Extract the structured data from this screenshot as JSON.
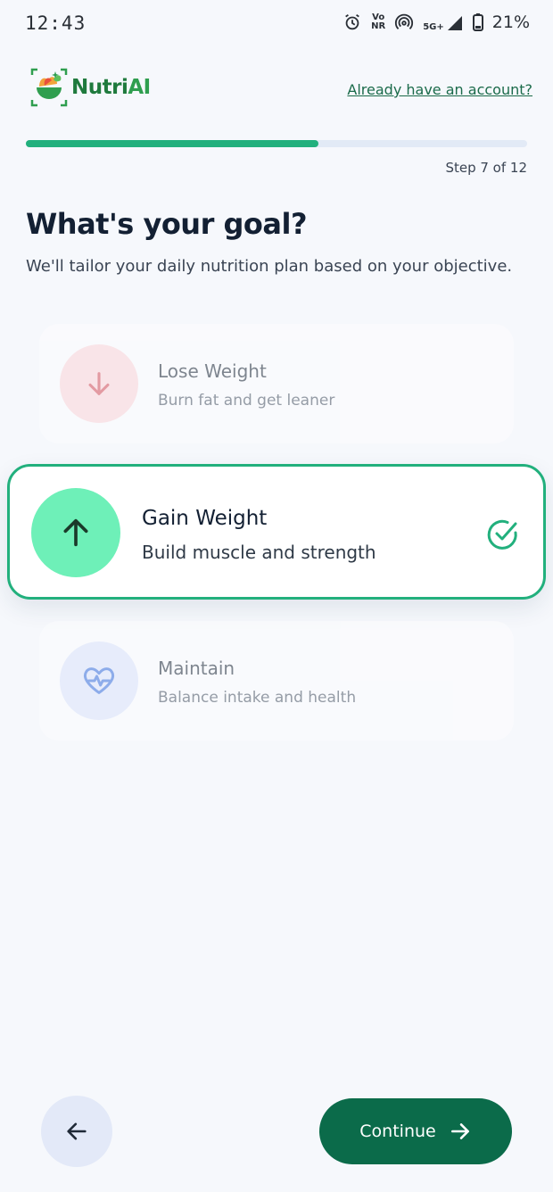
{
  "status_bar": {
    "time": "12:43",
    "volte_top": "Vo",
    "volte_bottom": "NR",
    "network": "5G+",
    "battery": "21%"
  },
  "header": {
    "logo_text_a": "Nutri",
    "logo_text_b": "AI",
    "signin_link": "Already have an account?"
  },
  "progress": {
    "step_label": "Step 7 of 12",
    "fraction": 0.583
  },
  "page": {
    "title": "What's your goal?",
    "subtitle": "We'll tailor your daily nutrition plan based on your objective."
  },
  "options": [
    {
      "title": "Lose Weight",
      "subtitle": "Burn fat and get leaner",
      "icon": "arrow-down-icon",
      "color": "#fbd9dc",
      "selected": false
    },
    {
      "title": "Gain Weight",
      "subtitle": "Build muscle and strength",
      "icon": "arrow-up-icon",
      "color": "#6ef0b8",
      "selected": true
    },
    {
      "title": "Maintain",
      "subtitle": "Balance intake and health",
      "icon": "heart-pulse-icon",
      "color": "#dfe5fb",
      "selected": false
    }
  ],
  "footer": {
    "continue_label": "Continue"
  },
  "colors": {
    "accent": "#22b07d",
    "primary_button": "#0b6b4a",
    "background": "#f6f8fc"
  }
}
